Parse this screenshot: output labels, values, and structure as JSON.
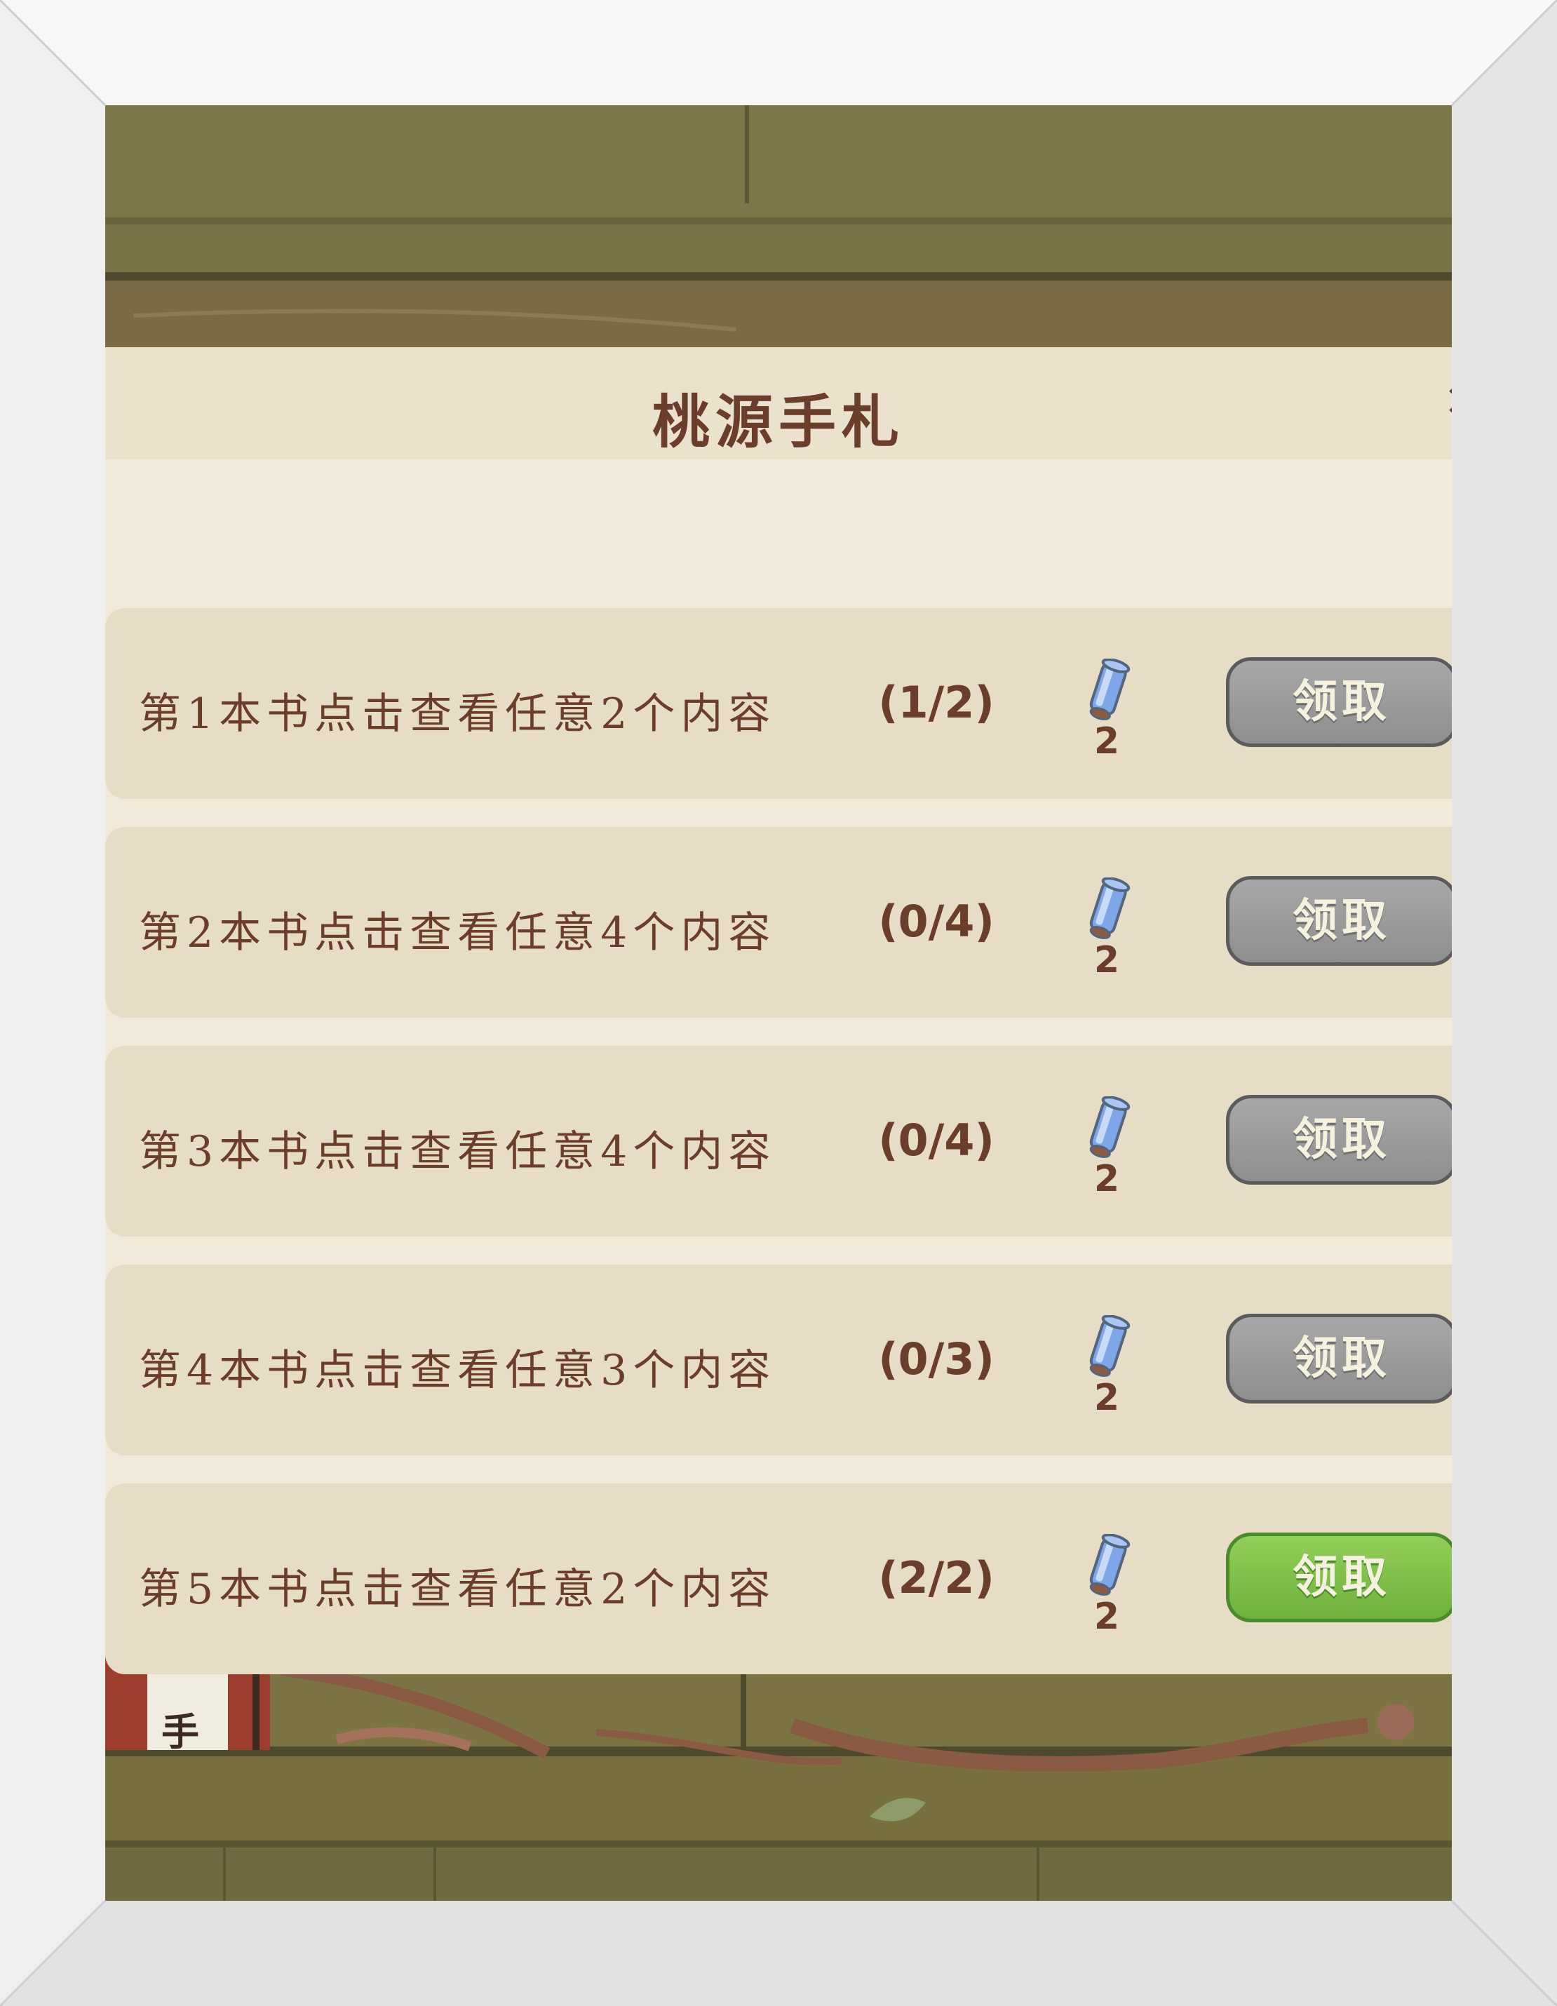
{
  "panel": {
    "title": "桃源手札"
  },
  "tasks": [
    {
      "description": "第1本书点击查看任意2个内容",
      "progress": "(1/2)",
      "reward_count": "2",
      "claim_label": "领取",
      "claimable": false
    },
    {
      "description": "第2本书点击查看任意4个内容",
      "progress": "(0/4)",
      "reward_count": "2",
      "claim_label": "领取",
      "claimable": false
    },
    {
      "description": "第3本书点击查看任意4个内容",
      "progress": "(0/4)",
      "reward_count": "2",
      "claim_label": "领取",
      "claimable": false
    },
    {
      "description": "第4本书点击查看任意3个内容",
      "progress": "(0/3)",
      "reward_count": "2",
      "claim_label": "领取",
      "claimable": false
    },
    {
      "description": "第5本书点击查看任意2个内容",
      "progress": "(2/2)",
      "reward_count": "2",
      "claim_label": "领取",
      "claimable": true
    }
  ],
  "shelf": {
    "book_spine_char": "手"
  },
  "icons": {
    "reward": "scroll-icon"
  },
  "colors": {
    "text_brown": "#6a3e2a",
    "claim_disabled": "#9a9a9a",
    "claim_active": "#7fbf48",
    "paper": "#f1eadb",
    "shelf_wood": "#7a7346"
  }
}
